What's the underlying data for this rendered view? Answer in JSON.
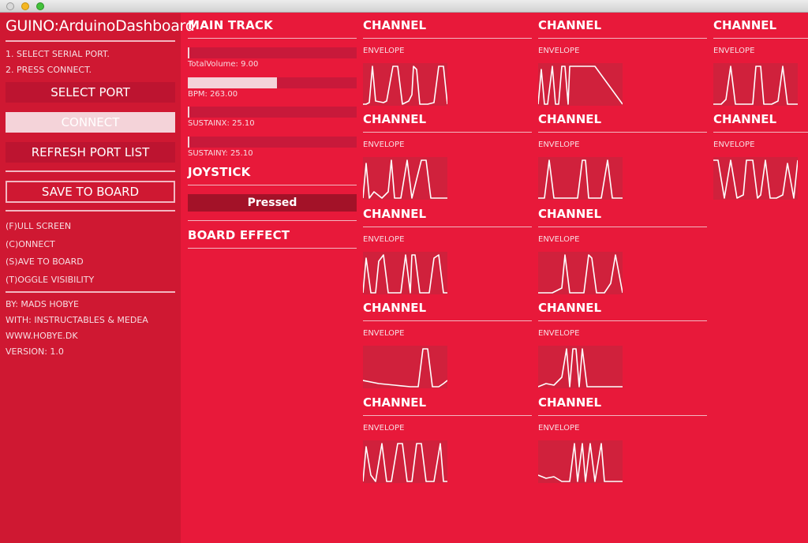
{
  "window": {
    "title": ""
  },
  "sidebar": {
    "app_title": "GUINO:ArduinoDashboard",
    "steps": [
      "1. SELECT SERIAL PORT.",
      "2. PRESS CONNECT."
    ],
    "select_port_label": "SELECT PORT",
    "connect_label": "CONNECT",
    "refresh_label": "REFRESH PORT LIST",
    "save_label": "SAVE TO BOARD",
    "shortcuts": [
      "(F)ULL SCREEN",
      "(C)ONNECT",
      "(S)AVE TO BOARD",
      "(T)OGGLE VISIBILITY"
    ],
    "credits": [
      "BY: MADS HOBYE",
      "WITH: INSTRUCTABLES & MEDEA",
      "WWW.HOBYE.DK",
      "VERSION: 1.0"
    ]
  },
  "main_track": {
    "title": "MAIN TRACK",
    "sliders": [
      {
        "label": "TotalVolume: 9.00",
        "fraction": 0.0
      },
      {
        "label": "BPM: 263.00",
        "fraction": 0.53
      },
      {
        "label": "SUSTAINX: 25.10",
        "fraction": 0.0
      },
      {
        "label": "SUSTAINY: 25.10",
        "fraction": 0.0
      }
    ],
    "joystick_title": "JOYSTICK",
    "pressed_label": "Pressed",
    "board_effect_title": "BOARD EFFECT"
  },
  "colors": {
    "background": "#e8193a",
    "sidebar": "#cf1832",
    "button": "#bd1430",
    "pressed": "#a31228"
  },
  "channels": [
    {
      "title": "CHANNEL",
      "envelope_label": "ENVELOPE",
      "wave": "a"
    },
    {
      "title": "CHANNEL",
      "envelope_label": "ENVELOPE",
      "wave": "b"
    },
    {
      "title": "CHANNEL",
      "envelope_label": "ENVELOPE",
      "wave": "c"
    },
    {
      "title": "CHANNEL",
      "envelope_label": "ENVELOPE",
      "wave": "d"
    },
    {
      "title": "CHANNEL",
      "envelope_label": "ENVELOPE",
      "wave": "e"
    },
    {
      "title": "CHANNEL",
      "envelope_label": "ENVELOPE",
      "wave": "f"
    },
    {
      "title": "CHANNEL",
      "envelope_label": "ENVELOPE",
      "wave": "g"
    },
    {
      "title": "CHANNEL",
      "envelope_label": "ENVELOPE",
      "wave": "h"
    },
    {
      "title": "CHANNEL",
      "envelope_label": "ENVELOPE",
      "wave": "i"
    },
    {
      "title": "CHANNEL",
      "envelope_label": "ENVELOPE",
      "wave": "j"
    },
    {
      "title": "CHANNEL",
      "envelope_label": "ENVELOPE",
      "wave": "k"
    },
    {
      "title": "CHANNEL",
      "envelope_label": "ENVELOPE",
      "wave": "l"
    }
  ]
}
